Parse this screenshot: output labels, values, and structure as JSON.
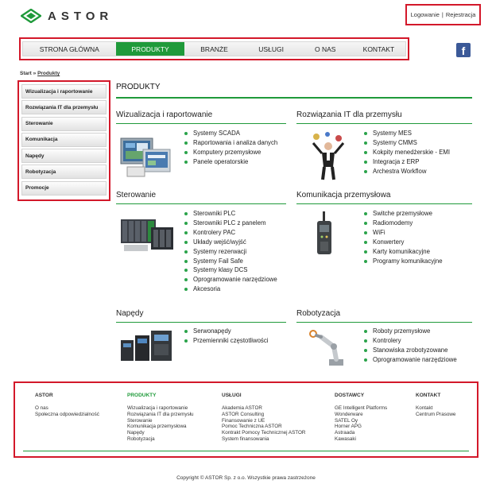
{
  "brand": {
    "name": "ASTOR",
    "green": "#1f9a3a",
    "highlight_red": "#d3182a"
  },
  "auth": {
    "login": "Logowanie",
    "register": "Rejestracja",
    "separator": "|"
  },
  "nav": {
    "items": [
      "STRONA GŁÓWNA",
      "PRODUKTY",
      "BRANŻE",
      "USŁUGI",
      "O NAS",
      "KONTAKT"
    ],
    "active": "PRODUKTY",
    "social_icon": "facebook-icon"
  },
  "breadcrumb": {
    "start": "Start",
    "sep": "»",
    "current": "Produkty"
  },
  "sidebar": {
    "items": [
      "Wizualizacja i raportowanie",
      "Rozwiązania IT dla przemysłu",
      "Sterowanie",
      "Komunikacja",
      "Napędy",
      "Robotyzacja",
      "Promocje"
    ]
  },
  "main": {
    "title": "PRODUKTY",
    "sections": [
      {
        "title": "Wizualizacja i raportowanie",
        "image": "scada-panel-image",
        "items": [
          "Systemy SCADA",
          "Raportowania i analiza danych",
          "Komputery przemysłowe",
          "Panele operatorskie"
        ]
      },
      {
        "title": "Rozwiązania IT dla przemysłu",
        "image": "juggler-image",
        "items": [
          "Systemy MES",
          "Systemy CMMS",
          "Kokpity menedżerskie - EMI",
          "Integracja z ERP",
          "Archestra Workflow"
        ]
      },
      {
        "title": "Sterowanie",
        "image": "plc-image",
        "items": [
          "Sterowniki PLC",
          "Sterowniki PLC z panelem",
          "Kontrolery PAC",
          "Układy wejść/wyjść",
          "Systemy rezerwacji",
          "Systemy Fail Safe",
          "Systemy klasy DCS",
          "Oprogramowanie narzędziowe",
          "Akcesoria"
        ]
      },
      {
        "title": "Komunikacja przemysłowa",
        "image": "radio-modem-image",
        "items": [
          "Switche przemysłowe",
          "Radiomodemy",
          "WiFi",
          "Konwertery",
          "Karty komunikacyjne",
          "Programy komunikacyjne"
        ]
      },
      {
        "title": "Napędy",
        "image": "drives-image",
        "items": [
          "Serwonapędy",
          "Przemienniki częstotliwości"
        ]
      },
      {
        "title": "Robotyzacja",
        "image": "robot-arm-image",
        "items": [
          "Roboty przemysłowe",
          "Kontrolery",
          "Stanowiska zrobotyzowane",
          "Oprogramowanie narzędziowe"
        ]
      }
    ]
  },
  "footer": {
    "columns": [
      {
        "title": "ASTOR",
        "items": [
          "O nas",
          "Społeczna odpowiedzialność"
        ]
      },
      {
        "title": "PRODUKTY",
        "items": [
          "Wizualizacja i raportowanie",
          "Rozwiązania IT dla przemysłu",
          "Sterowanie",
          "Komunikacja przemysłowa",
          "Napędy",
          "Robotyzacja"
        ]
      },
      {
        "title": "USŁUGI",
        "items": [
          "Akademia ASTOR",
          "ASTOR Consulting",
          "Finansowanie z UE",
          "Pomoc Techniczna ASTOR",
          "Kontrakt Pomocy Technicznej ASTOR",
          "System finansowania"
        ]
      },
      {
        "title": "DOSTAWCY",
        "items": [
          "GE Intelligent Platforms",
          "Wonderware",
          "SATEL Oy",
          "Horner APG",
          "Astraada",
          "Kawasaki"
        ]
      },
      {
        "title": "KONTAKT",
        "items": [
          "Kontakt",
          "Centrum Prasowe"
        ]
      }
    ],
    "copyright": "Copyright © ASTOR Sp. z o.o. Wszystkie prawa zastrzeżone"
  }
}
